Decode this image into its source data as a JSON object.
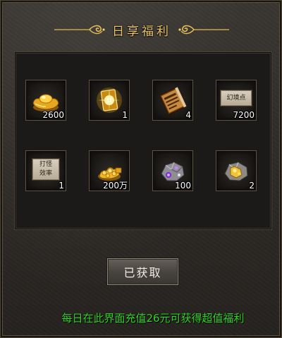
{
  "title": "日享福利",
  "items": [
    {
      "icon": "gold-ingot-icon",
      "count": "2600"
    },
    {
      "icon": "glowing-card-icon",
      "count": "1"
    },
    {
      "icon": "book-icon",
      "count": "4"
    },
    {
      "icon": "illusion-points-icon",
      "label": "幻境点",
      "count": "7200"
    },
    {
      "icon": "monster-efficiency-icon",
      "label": "打怪效率",
      "count": "1"
    },
    {
      "icon": "gold-pile-icon",
      "count": "200万"
    },
    {
      "icon": "purple-ore-icon",
      "count": "100"
    },
    {
      "icon": "gold-ore-icon",
      "count": "2"
    }
  ],
  "claim_button": "已获取",
  "footer": "每日在此界面充值26元可获得超值福利",
  "colors": {
    "title": "#e9c46a",
    "footer": "#34d426"
  }
}
